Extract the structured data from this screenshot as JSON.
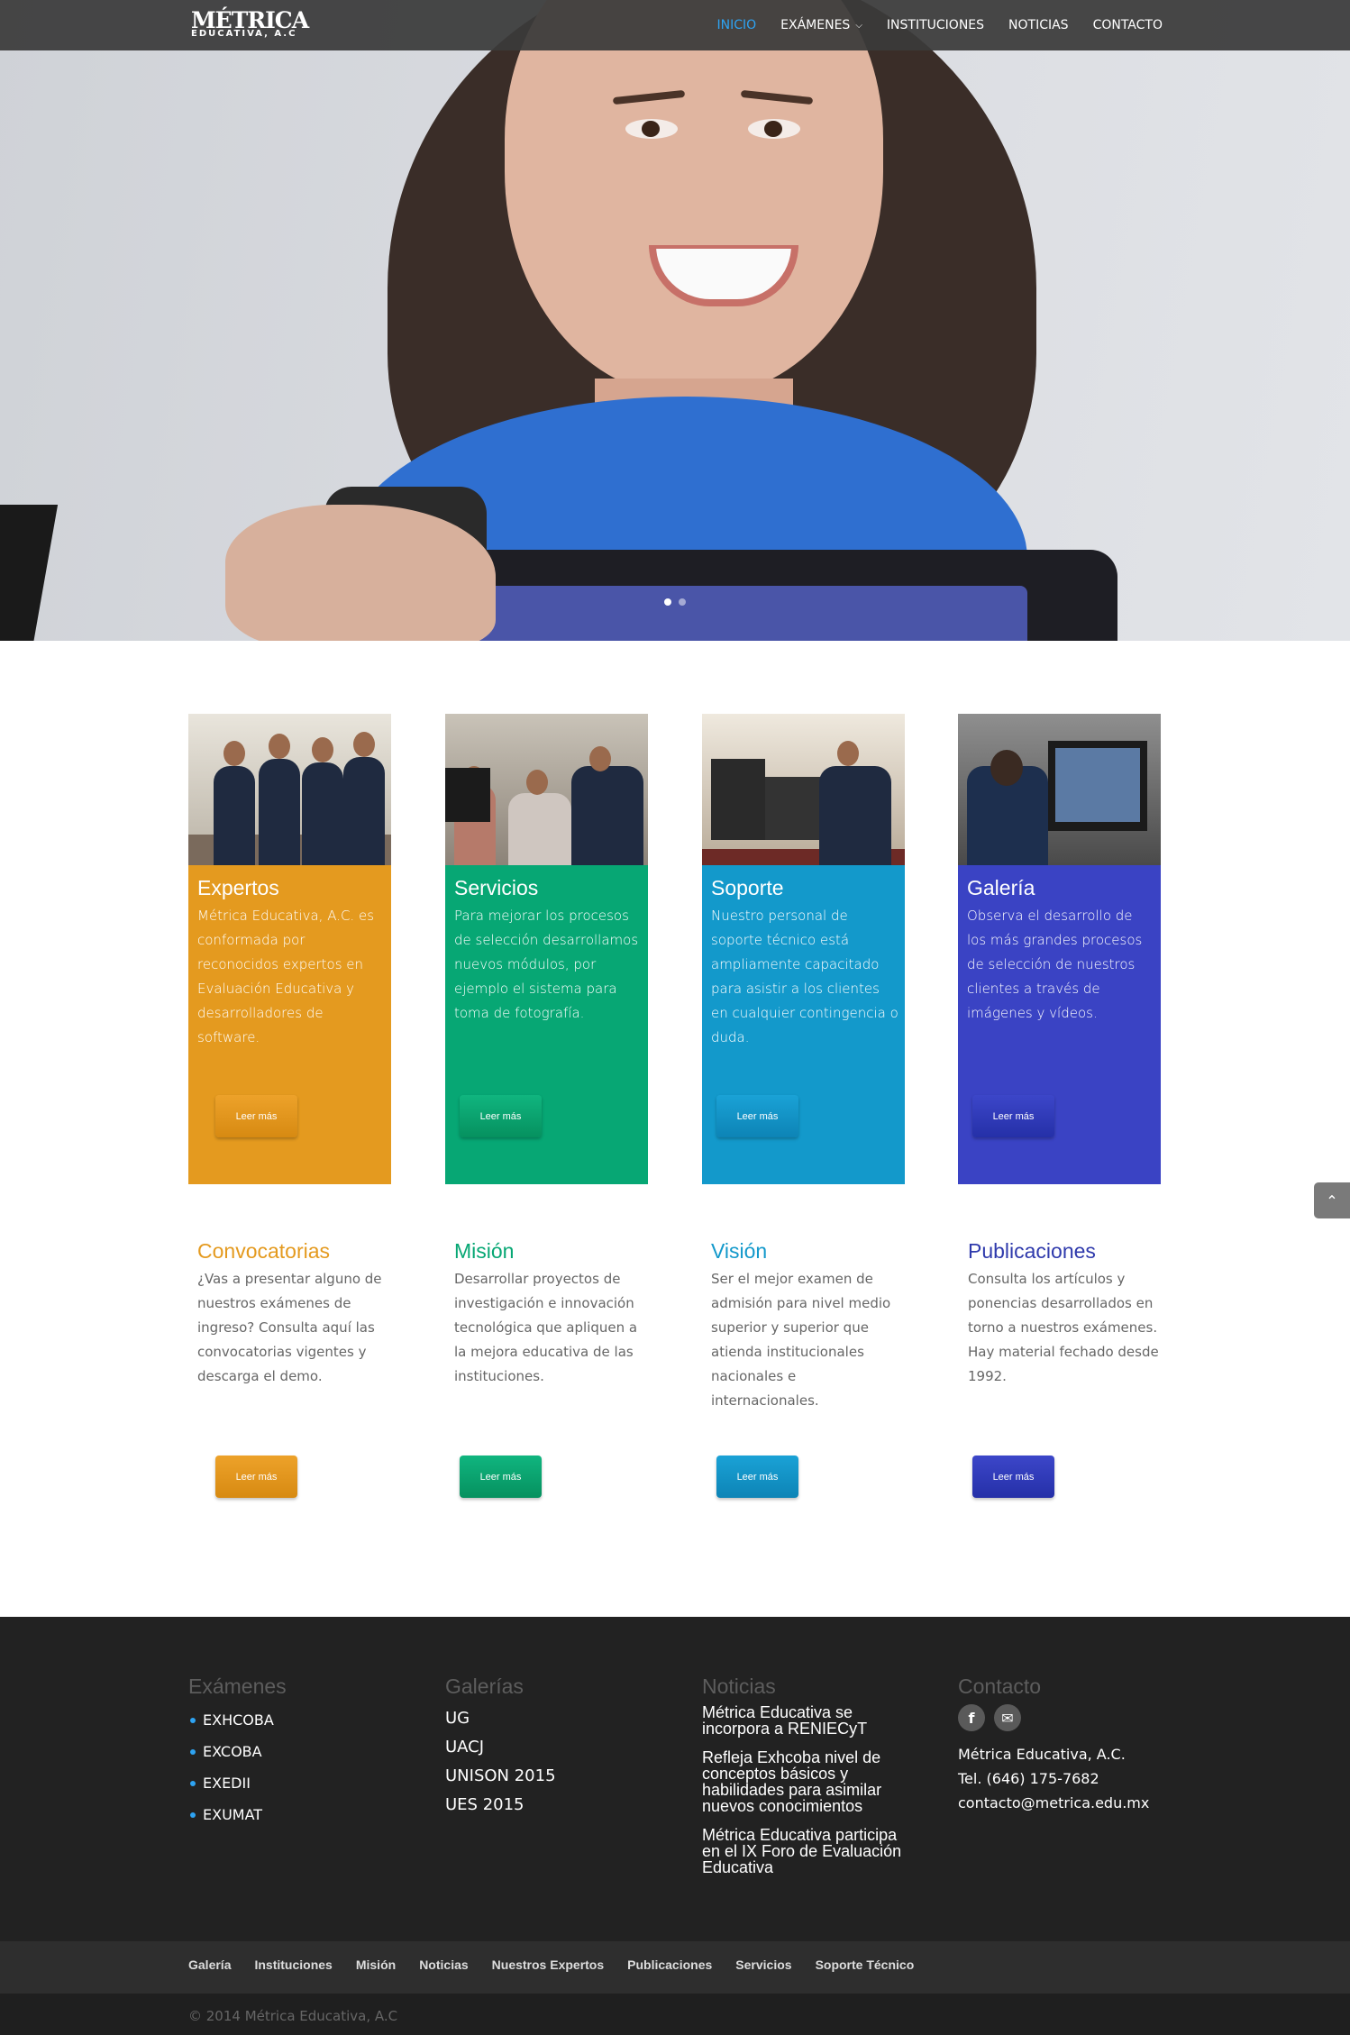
{
  "header": {
    "logo_top": "MÉTRICA",
    "logo_bottom": "EDUCATIVA, A.C",
    "nav": [
      {
        "label": "INICIO"
      },
      {
        "label": "EXÁMENES"
      },
      {
        "label": "INSTITUCIONES"
      },
      {
        "label": "NOTICIAS"
      },
      {
        "label": "CONTACTO"
      }
    ],
    "active_color": "#2ea3f2"
  },
  "hero": {
    "slides": 2,
    "active_slide": 1
  },
  "cards": [
    {
      "title": "Expertos",
      "text": "Métrica Educativa, A.C. es conformada por reconocidos expertos en Evaluación Educativa y desarrolladores de software.",
      "button": "Leer más",
      "color": "#e49a1f"
    },
    {
      "title": "Servicios",
      "text": "Para mejorar los procesos de selección desarrollamos nuevos módulos, por ejemplo el sistema para toma de fotografía.",
      "button": "Leer más",
      "color": "#07a774"
    },
    {
      "title": "Soporte",
      "text": "Nuestro personal de soporte técnico está ampliamente capacitado para asistir a los clientes en cualquier contingencia o duda.",
      "button": "Leer más",
      "color": "#1399cb"
    },
    {
      "title": "Galería",
      "text": "Observa el desarrollo de los más grandes procesos de selección de nuestros clientes a través de imágenes y vídeos.",
      "button": "Leer más",
      "color": "#3a43c4"
    }
  ],
  "info": [
    {
      "title": "Convocatorias",
      "text": "¿Vas a presentar alguno de nuestros exámenes de ingreso? Consulta aquí las convocatorias vigentes y descarga el demo.",
      "button": "Leer más"
    },
    {
      "title": "Misión",
      "text": "Desarrollar proyectos de investigación e innovación tecnológica que apliquen a la mejora educativa de las instituciones.",
      "button": "Leer más"
    },
    {
      "title": "Visión",
      "text": "Ser el mejor examen de admisión para nivel medio superior y superior que atienda institucionales nacionales e internacionales.",
      "button": "Leer más"
    },
    {
      "title": "Publicaciones",
      "text": "Consulta los artículos y ponencias desarrollados en torno a nuestros exámenes. Hay material fechado desde 1992.",
      "button": "Leer más"
    }
  ],
  "footer": {
    "examenes": {
      "title": "Exámenes",
      "items": [
        "EXHCOBA",
        "EXCOBA",
        "EXEDII",
        "EXUMAT"
      ]
    },
    "galerias": {
      "title": "Galerías",
      "items": [
        "UG",
        "UACJ",
        "UNISON 2015",
        "UES 2015"
      ]
    },
    "noticias": {
      "title": "Noticias",
      "items": [
        "Métrica Educativa se incorpora a RENIECyT",
        "Refleja Exhcoba nivel de conceptos básicos y habilidades para asimilar nuevos conocimientos",
        "Métrica Educativa participa en el IX Foro de Evaluación Educativa"
      ]
    },
    "contacto": {
      "title": "Contacto",
      "name": "Métrica Educativa, A.C.",
      "phone": "Tel. (646) 175-7682",
      "email": "contacto@metrica.edu.mx",
      "social_icons": [
        "facebook-icon",
        "email-icon"
      ]
    }
  },
  "bottom_links": [
    "Galería",
    "Instituciones",
    "Misión",
    "Noticias",
    "Nuestros Expertos",
    "Publicaciones",
    "Servicios",
    "Soporte Técnico"
  ],
  "copyright": "© 2014 Métrica Educativa, A.C"
}
